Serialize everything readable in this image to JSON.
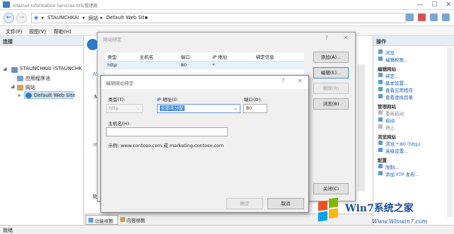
{
  "window": {
    "title": "Internet Information Services (IIS)管理器"
  },
  "address": {
    "path": [
      "STAUNCHKAI",
      "网站",
      "Default Web Site"
    ]
  },
  "menu": [
    "文件(F)",
    "视图(V)",
    "帮助(H)"
  ],
  "left_pane": {
    "header": "连接",
    "tree": [
      "STAUNCHKAI (STAUNCHK",
      "应用程序池",
      "网站",
      "Default Web Site"
    ]
  },
  "center": {
    "tabs": [
      "功能视图",
      "内容视图"
    ]
  },
  "bindings_dialog": {
    "title": "网站绑定",
    "columns": [
      "类型",
      "主机名",
      "端口",
      "IP 地址",
      "绑定信息"
    ],
    "rows": [
      {
        "type": "http",
        "host": "",
        "port": "80",
        "ip": "*",
        "info": ""
      }
    ],
    "buttons": {
      "add": "添加(A)...",
      "edit": "编辑(E)...",
      "remove": "删除(R)",
      "browse": "浏览(B)",
      "close": "关闭(C)"
    }
  },
  "edit_dialog": {
    "title": "编辑网站绑定",
    "type_label": "类型(T):",
    "type_value": "http",
    "ip_label": "IP 地址(I):",
    "ip_value": "全部未分配",
    "port_label": "端口(O):",
    "port_value": "80",
    "host_label": "主机名(H):",
    "host_value": "",
    "example": "示例: www.contoso.com 或 marketing.contoso.com",
    "ok": "确定",
    "cancel": "取消"
  },
  "actions": {
    "header": "操作",
    "items": [
      {
        "text": "浏览",
        "kind": "link"
      },
      {
        "text": "编辑权限...",
        "kind": "link"
      },
      {
        "text": "编辑网站",
        "kind": "head"
      },
      {
        "text": "绑定...",
        "kind": "link"
      },
      {
        "text": "基本设置...",
        "kind": "link"
      },
      {
        "text": "查看应用程序",
        "kind": "link"
      },
      {
        "text": "查看虚拟目录",
        "kind": "link"
      },
      {
        "text": "管理网站",
        "kind": "head"
      },
      {
        "text": "重新启动",
        "kind": "gray"
      },
      {
        "text": "启动",
        "kind": "link"
      },
      {
        "text": "停止",
        "kind": "gray"
      },
      {
        "text": "浏览网站",
        "kind": "head"
      },
      {
        "text": "浏览 *:80 (http)",
        "kind": "link"
      },
      {
        "text": "高级设置...",
        "kind": "link"
      },
      {
        "text": "配置",
        "kind": "head"
      },
      {
        "text": "限制...",
        "kind": "link"
      },
      {
        "text": "添加 FTP 发布...",
        "kind": "link"
      }
    ]
  },
  "status": {
    "text": "就绪"
  },
  "watermark": {
    "brand": "Win7系统之家",
    "url": "Www.Winwin7.com"
  }
}
